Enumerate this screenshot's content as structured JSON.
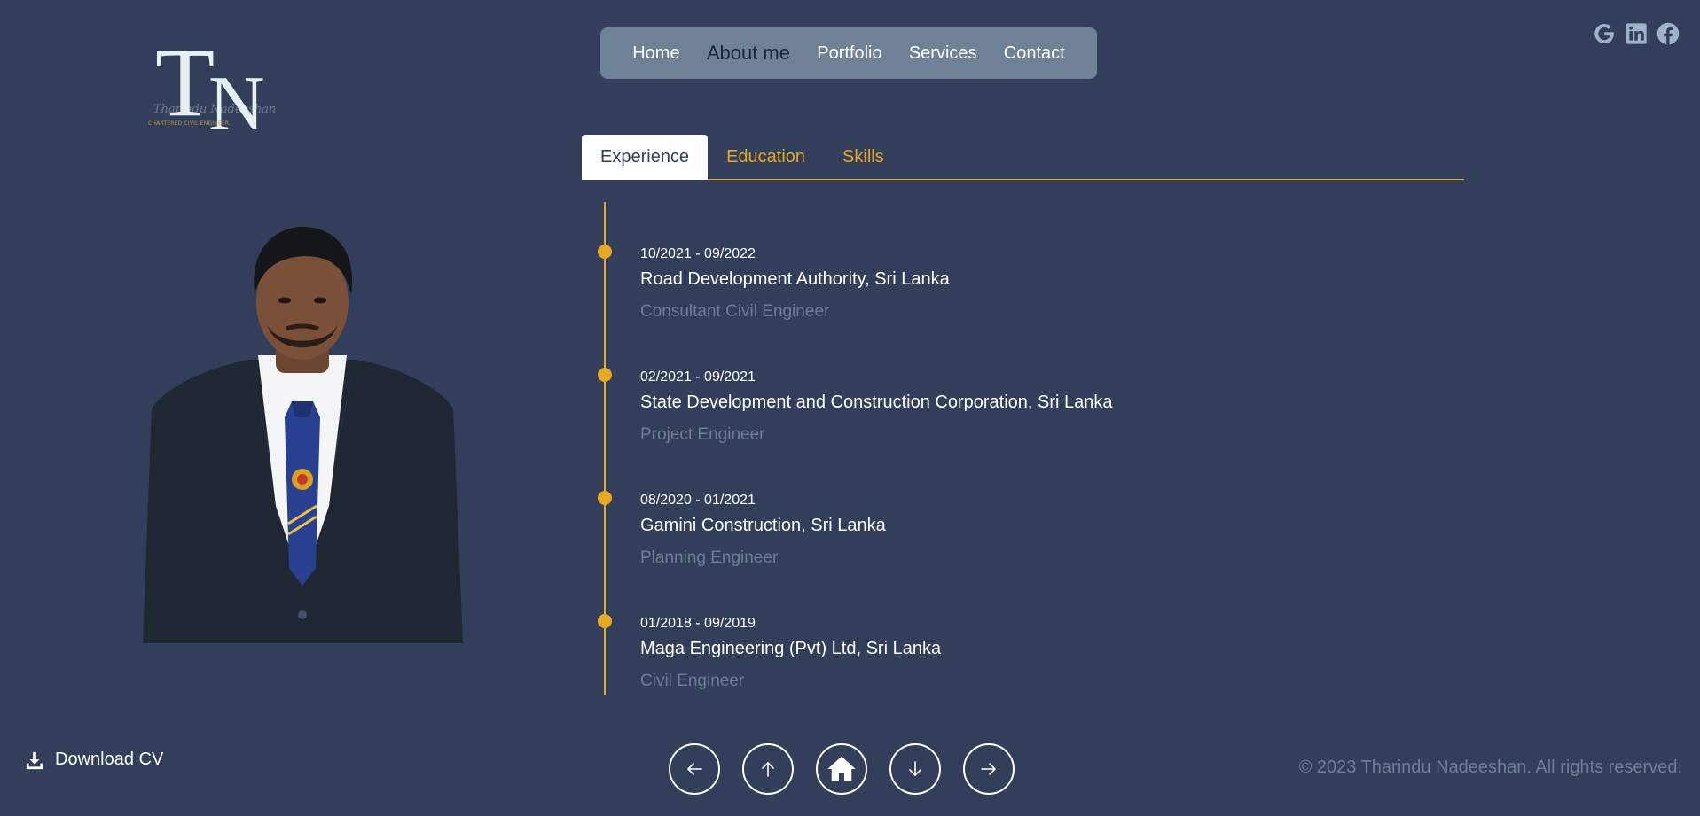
{
  "logo": {
    "letter_t": "T",
    "letter_n": "N",
    "script": "Tharindu Nadeeshan",
    "tiny": "CHARTERED CIVIL ENGINEER"
  },
  "nav": {
    "items": [
      {
        "label": "Home"
      },
      {
        "label": "About me",
        "active": true
      },
      {
        "label": "Portfolio"
      },
      {
        "label": "Services"
      },
      {
        "label": "Contact"
      }
    ]
  },
  "social": [
    "google-icon",
    "linkedin-icon",
    "facebook-icon"
  ],
  "tabs": [
    {
      "label": "Experience",
      "active": true
    },
    {
      "label": "Education"
    },
    {
      "label": "Skills"
    }
  ],
  "experience": [
    {
      "date": "10/2021 - 09/2022",
      "org": "Road Development Authority, Sri Lanka",
      "role": "Consultant Civil Engineer"
    },
    {
      "date": "02/2021 - 09/2021",
      "org": "State Development and Construction Corporation, Sri Lanka",
      "role": "Project Engineer"
    },
    {
      "date": "08/2020 - 01/2021",
      "org": "Gamini Construction, Sri Lanka",
      "role": "Planning Engineer"
    },
    {
      "date": "01/2018 - 09/2019",
      "org": "Maga Engineering (Pvt) Ltd, Sri Lanka",
      "role": "Civil Engineer"
    }
  ],
  "download": {
    "label": "Download CV"
  },
  "bottom_nav": [
    "arrow-left-icon",
    "arrow-up-icon",
    "home-icon",
    "arrow-down-icon",
    "arrow-right-icon"
  ],
  "footer": {
    "copyright": "© 2023 Tharindu Nadeeshan. All rights reserved."
  },
  "colors": {
    "background": "#333e5a",
    "accent": "#e7a823",
    "nav_bg": "#6f8196",
    "muted": "#6f7d96"
  }
}
